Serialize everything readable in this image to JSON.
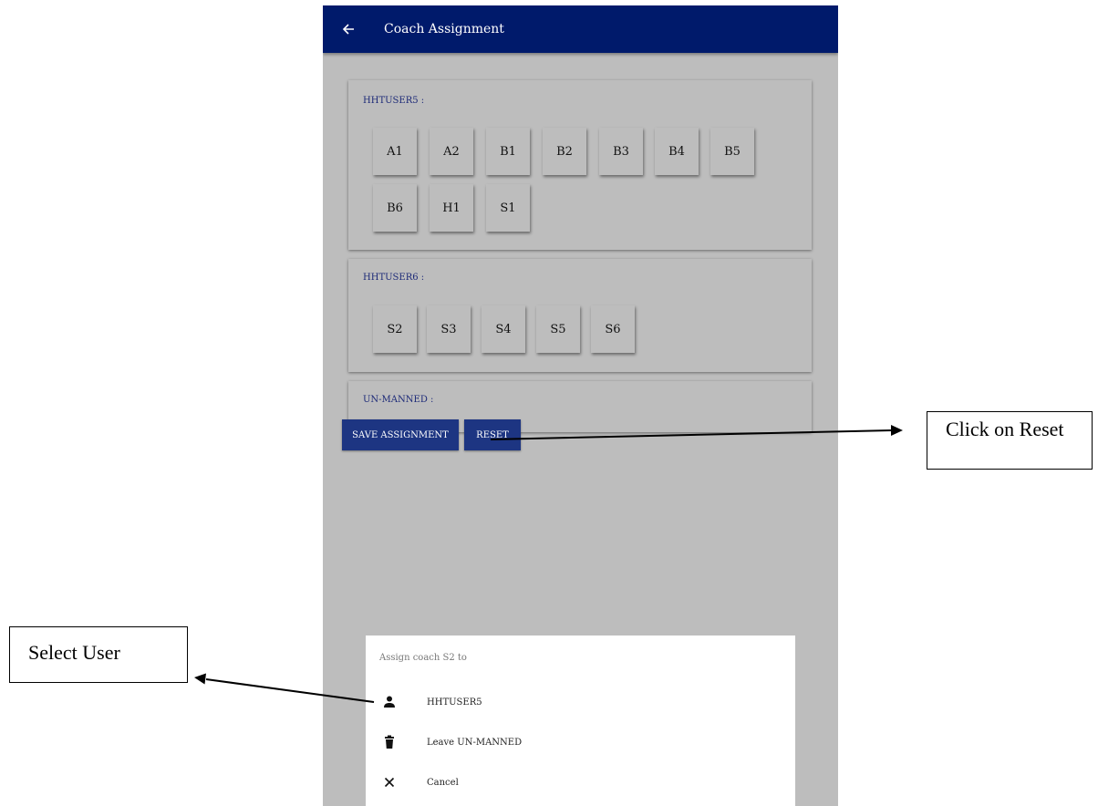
{
  "appbar": {
    "title": "Coach Assignment",
    "back_icon": "arrow-left-icon"
  },
  "sections": [
    {
      "title": "HHTUSER5 :",
      "coaches": [
        "A1",
        "A2",
        "B1",
        "B2",
        "B3",
        "B4",
        "B5",
        "B6",
        "H1",
        "S1"
      ]
    },
    {
      "title": "HHTUSER6 :",
      "coaches": [
        "S2",
        "S3",
        "S4",
        "S5",
        "S6"
      ]
    },
    {
      "title": "UN-MANNED :",
      "coaches": []
    }
  ],
  "buttons": {
    "save": "SAVE ASSIGNMENT",
    "reset": "RESET"
  },
  "sheet": {
    "title": "Assign coach S2 to",
    "options": [
      {
        "label": "HHTUSER5",
        "icon": "person-icon"
      },
      {
        "label": "Leave UN-MANNED",
        "icon": "trash-icon"
      },
      {
        "label": "Cancel",
        "icon": "close-icon"
      }
    ]
  },
  "annotations": {
    "reset_note": "Click on Reset",
    "select_note": "Select User"
  },
  "colors": {
    "appbar": "#001a6b",
    "button": "#1d3582",
    "background": "#bdbdbd",
    "section_title": "#1d2a78"
  }
}
